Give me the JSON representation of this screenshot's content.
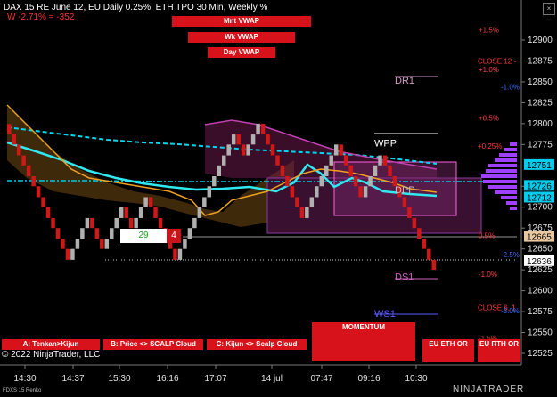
{
  "header": {
    "title": "DAX 15  RE June 12, EU Daily 0.25%, ETH TPO 30 Min, Weekly %",
    "subtitle": "W -2.71% = -352"
  },
  "vwap_buttons": [
    "Mnt VWAP",
    "Wk VWAP",
    "Day VWAP"
  ],
  "bottom_buttons": [
    "A: Tenkan>Kijun",
    "B: Price <> SCALP Cloud",
    "C: Kijun <> Scalp Cloud",
    "MOMENTUM",
    "EU ETH OR",
    "EU RTH OR"
  ],
  "copyright": "© 2022 NinjaTrader, LLC",
  "footer_left": "FDXS 15 Renko",
  "footer_right": "NINJATRADER",
  "close_glyph": "×",
  "counter_box": {
    "value": "29",
    "flag": "4"
  },
  "level_labels": [
    {
      "text": "+1.5%",
      "price": 12912,
      "color": "#ff3b3b"
    },
    {
      "text": "CLOSE 12 -",
      "price": 12875,
      "color": "#ff3b3b"
    },
    {
      "text": "+1.0%",
      "price": 12865,
      "color": "#ff3b3b"
    },
    {
      "text": "-1.0%",
      "price": 12844,
      "color": "#3b6bff"
    },
    {
      "text": "+0.5%",
      "price": 12807,
      "color": "#ff3b3b"
    },
    {
      "text": "+0.25%",
      "price": 12773,
      "color": "#ff3b3b"
    },
    {
      "text": "0.5%",
      "price": 12666,
      "color": "#ff3b3b"
    },
    {
      "text": "-2.5%",
      "price": 12643,
      "color": "#3b6bff"
    },
    {
      "text": "-1.0%",
      "price": 12620,
      "color": "#ff3b3b"
    },
    {
      "text": "CLOSE 6, 1",
      "price": 12580,
      "color": "#ff3b3b"
    },
    {
      "text": "-3.0%",
      "price": 12576,
      "color": "#3b6bff"
    },
    {
      "text": "-1.5%",
      "price": 12543,
      "color": "#ff3b3b"
    }
  ],
  "pivot_labels": [
    {
      "text": "DR1",
      "price": 12852,
      "color": "#d49ac8"
    },
    {
      "text": "WPP",
      "price": 12777,
      "color": "#ffffff"
    },
    {
      "text": "DPP",
      "price": 12721,
      "color": "#c0c0c0"
    },
    {
      "text": "DS1",
      "price": 12617,
      "color": "#d060c0"
    },
    {
      "text": "WS1",
      "price": 12573,
      "color": "#5a5aff"
    }
  ],
  "price_axis": [
    "12900",
    "12875",
    "12850",
    "12825",
    "12800",
    "12775",
    "12725",
    "12700",
    "12675",
    "12650",
    "12625",
    "12600",
    "12575",
    "12550",
    "12525"
  ],
  "price_tags": [
    {
      "text": "12751",
      "bg": "#00ccee",
      "fg": "#000"
    },
    {
      "text": "12726",
      "bg": "#00ccee",
      "fg": "#000"
    },
    {
      "text": "12712",
      "bg": "#00ccee",
      "fg": "#000"
    },
    {
      "text": "12665",
      "bg": "#e8c8a0",
      "fg": "#000"
    },
    {
      "text": "12636",
      "bg": "#ffffff",
      "fg": "#000"
    }
  ],
  "time_axis": [
    "14:30",
    "14:37",
    "15:30",
    "16:16",
    "17:07",
    "14 jul",
    "07:47",
    "09:16",
    "10:30"
  ],
  "chart_data": {
    "type": "renko",
    "brick_size": 12.5,
    "closes": [
      12787,
      12775,
      12762,
      12750,
      12737,
      12725,
      12712,
      12700,
      12687,
      12675,
      12662,
      12650,
      12637,
      12650,
      12662,
      12675,
      12687,
      12675,
      12662,
      12650,
      12662,
      12675,
      12687,
      12700,
      12687,
      12675,
      12687,
      12700,
      12712,
      12700,
      12687,
      12675,
      12662,
      12650,
      12637,
      12650,
      12662,
      12675,
      12687,
      12700,
      12712,
      12725,
      12737,
      12750,
      12762,
      12775,
      12787,
      12775,
      12762,
      12775,
      12787,
      12800,
      12787,
      12775,
      12762,
      12750,
      12737,
      12725,
      12712,
      12700,
      12687,
      12700,
      12712,
      12725,
      12737,
      12750,
      12762,
      12775,
      12762,
      12750,
      12737,
      12725,
      12712,
      12725,
      12737,
      12750,
      12762,
      12750,
      12737,
      12725,
      12712,
      12700,
      12687,
      12675,
      12662,
      12650,
      12637,
      12625
    ],
    "ylim": [
      12520,
      12920
    ]
  }
}
